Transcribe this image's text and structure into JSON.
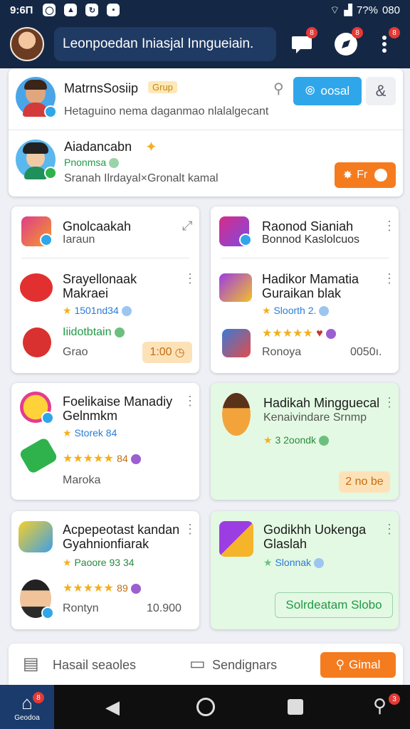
{
  "status_bar": {
    "time": "9:6П",
    "icons": [
      "whatsapp-icon",
      "gallery-icon",
      "sync-icon",
      "media-icon"
    ],
    "battery": "7?%",
    "extra": "080"
  },
  "app_bar": {
    "search_text": "Leonpoedan Iniasjal Inngueiain.",
    "chat_badge": "8",
    "explore_badge": "8",
    "menu_badge": "8"
  },
  "group_card": {
    "name": "MatrnsSosiip",
    "chip": "Grup",
    "description": "Hetaguino nema daganmao nlalalgecant",
    "join_button": "oosal"
  },
  "member_card": {
    "name": "Aiadancabn",
    "status": "Pnonmsa",
    "description": "Sranah Ilrdayal×Gronalt kamal",
    "action_button": "Fr"
  },
  "cards": [
    {
      "items": [
        {
          "title": "Gnolcaakah",
          "subtitle": "Iaraun"
        },
        {
          "title": "Srayellonaak",
          "subtitle": "Makraei",
          "rating": "1501nd34"
        },
        {
          "title": "Iiidotbtain",
          "footer_left": "Grao",
          "price": "1:00"
        }
      ]
    },
    {
      "items": [
        {
          "title": "Raonod Sianiah",
          "subtitle": "Bonnod Kaslolcuos"
        },
        {
          "title": "Hadikor Mamatia",
          "subtitle": "Guraikan blak",
          "rating": "Sloorth 2."
        },
        {
          "title": "Ronoya",
          "footer_right": "0050ı."
        }
      ]
    },
    {
      "items": [
        {
          "title": "Foelikaise Manadiy",
          "subtitle": "Gelnmkm",
          "rating": "Storek 84"
        },
        {
          "title": "Maroka",
          "rating_num": "84"
        }
      ]
    },
    {
      "items": [
        {
          "title": "Hadikah Mingguecal",
          "subtitle": "Kenaivindare Srnmp",
          "rating": "3 2oondk"
        },
        {
          "price": "2 no be"
        }
      ]
    },
    {
      "items": [
        {
          "title": "Acpepeotast kandan",
          "subtitle": "Gyahnionfiarak",
          "rating": "Paoore 93 34"
        },
        {
          "footer_left": "Rontyn",
          "footer_right": "10.900",
          "rating_num": "89"
        }
      ]
    },
    {
      "items": [
        {
          "title": "Godikhh Uokenga",
          "subtitle": "Glaslah",
          "rating": "Slonnak"
        },
        {
          "button": "Solrdeatam Slobo"
        }
      ]
    }
  ],
  "action_bar": {
    "left_label": "Hasail seaoles",
    "middle_label": "Sendignars",
    "button_label": "Gimal"
  },
  "nav_bar": {
    "home_label": "Geodoa",
    "home_badge": "8",
    "right_badge": "3"
  },
  "colors": {
    "header": "#142846",
    "accent_blue": "#30a6ea",
    "accent_orange": "#f57b1f",
    "green_card": "#e3f9e3",
    "star": "#f2b01e"
  }
}
